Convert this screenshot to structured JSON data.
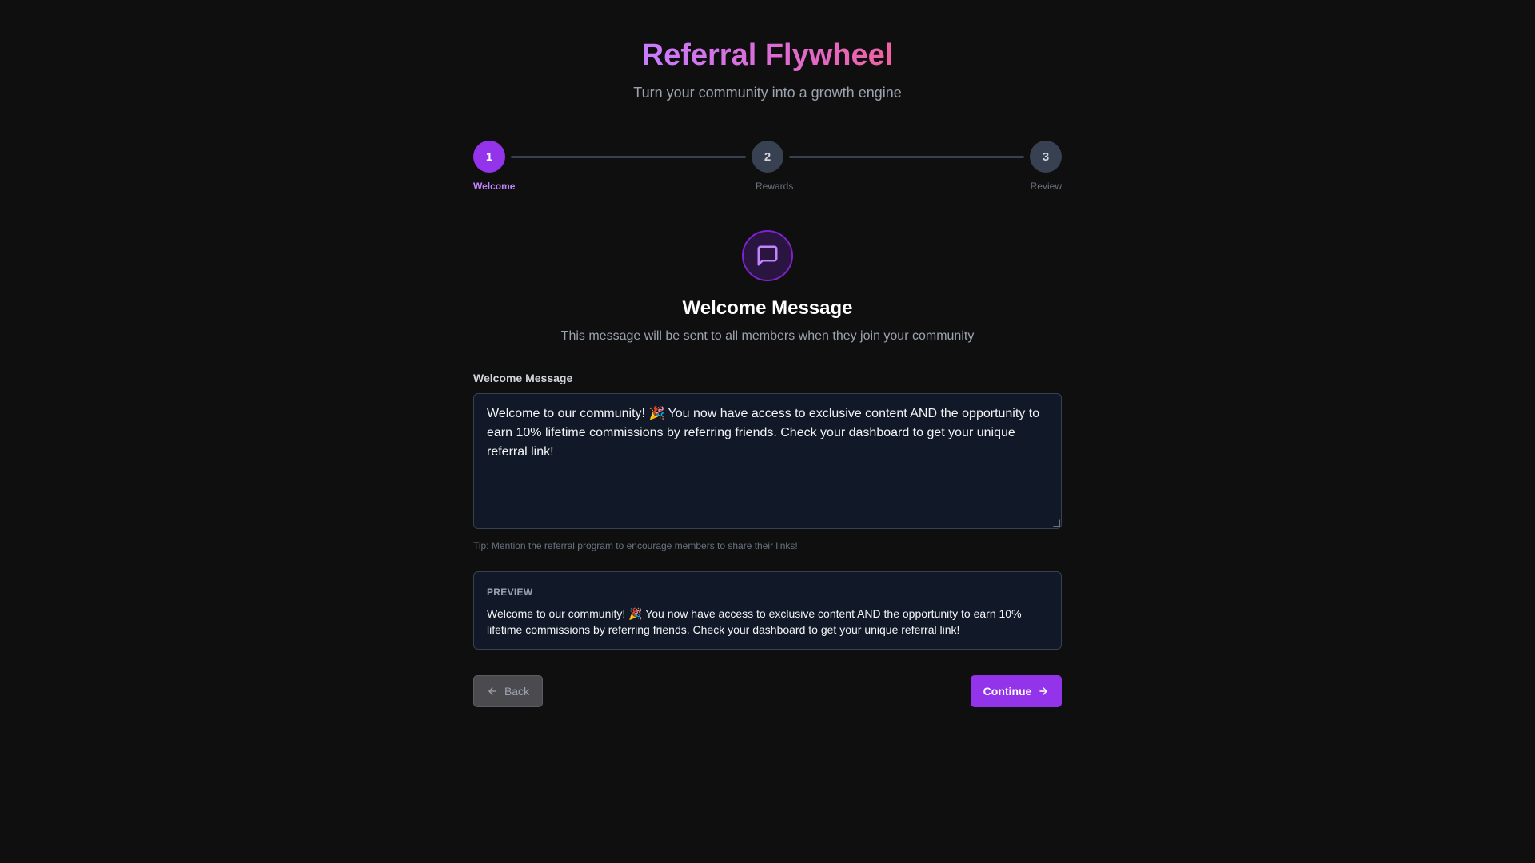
{
  "header": {
    "title": "Referral Flywheel",
    "subtitle": "Turn your community into a growth engine"
  },
  "stepper": {
    "current_step": 1,
    "steps": [
      {
        "number": "1",
        "label": "Welcome",
        "active": true
      },
      {
        "number": "2",
        "label": "Rewards",
        "active": false
      },
      {
        "number": "3",
        "label": "Review",
        "active": false
      }
    ]
  },
  "section": {
    "icon": "message-square-icon",
    "title": "Welcome Message",
    "description": "This message will be sent to all members when they join your community"
  },
  "form": {
    "field_label": "Welcome Message",
    "message_value": "Welcome to our community! 🎉 You now have access to exclusive content AND the opportunity to earn 10% lifetime commissions by referring friends. Check your dashboard to get your unique referral link!",
    "tip": "Tip: Mention the referral program to encourage members to share their links!"
  },
  "preview": {
    "label": "PREVIEW",
    "text": "Welcome to our community! 🎉 You now have access to exclusive content AND the opportunity to earn 10% lifetime commissions by referring friends. Check your dashboard to get your unique referral link!"
  },
  "actions": {
    "back_label": "Back",
    "back_icon": "arrow-left-icon",
    "continue_label": "Continue",
    "continue_icon": "arrow-right-icon"
  },
  "colors": {
    "background": "#0f0f10",
    "accent": "#9333ea",
    "accent_light": "#c084fc",
    "inactive_step": "#374151"
  }
}
